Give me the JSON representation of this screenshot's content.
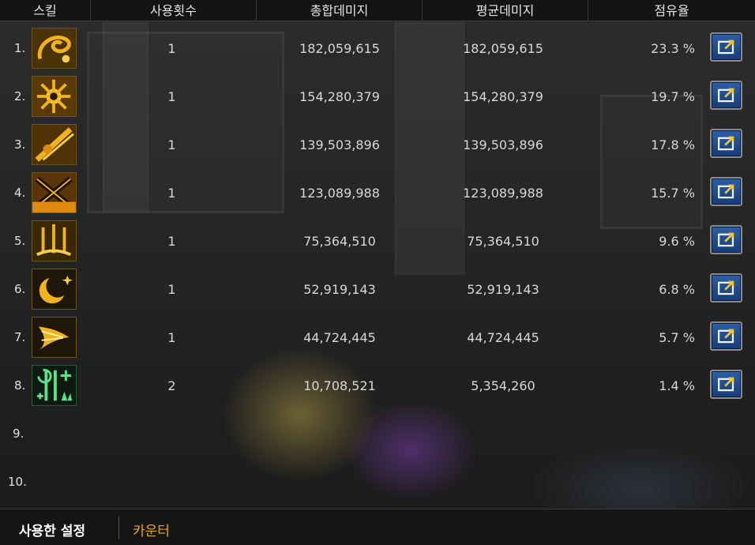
{
  "header": {
    "skill": "스킬",
    "uses": "사용횟수",
    "total_damage": "총합데미지",
    "avg_damage": "평균데미지",
    "share": "점유율"
  },
  "rows": [
    {
      "rank": "1.",
      "icon": "swirl-skill-icon",
      "uses": "1",
      "total": "182,059,615",
      "avg": "182,059,615",
      "share": "23.3 %"
    },
    {
      "rank": "2.",
      "icon": "burst-skill-icon",
      "uses": "1",
      "total": "154,280,379",
      "avg": "154,280,379",
      "share": "19.7 %"
    },
    {
      "rank": "3.",
      "icon": "slash-skill-icon",
      "uses": "1",
      "total": "139,503,896",
      "avg": "139,503,896",
      "share": "17.8 %"
    },
    {
      "rank": "4.",
      "icon": "cross-skill-icon",
      "uses": "1",
      "total": "123,089,988",
      "avg": "123,089,988",
      "share": "15.7 %"
    },
    {
      "rank": "5.",
      "icon": "swords-skill-icon",
      "uses": "1",
      "total": "75,364,510",
      "avg": "75,364,510",
      "share": "9.6 %"
    },
    {
      "rank": "6.",
      "icon": "crescent-moon-skill-icon",
      "uses": "1",
      "total": "52,919,143",
      "avg": "52,919,143",
      "share": "6.8 %"
    },
    {
      "rank": "7.",
      "icon": "wing-skill-icon",
      "uses": "1",
      "total": "44,724,445",
      "avg": "44,724,445",
      "share": "5.7 %"
    },
    {
      "rank": "8.",
      "icon": "buff-skill-icon",
      "uses": "2",
      "total": "10,708,521",
      "avg": "5,354,260",
      "share": "1.4 %"
    },
    {
      "rank": "9."
    },
    {
      "rank": "10."
    }
  ],
  "footer": {
    "tab_used": "사용한 설정",
    "tab_counter": "카운터"
  },
  "colors": {
    "header_bg": "#141414",
    "icon_gold": "#f2b21e",
    "icon_green": "#5fe08a",
    "share_button": "#2c5fa8",
    "counter_tab": "#e8a81a"
  }
}
